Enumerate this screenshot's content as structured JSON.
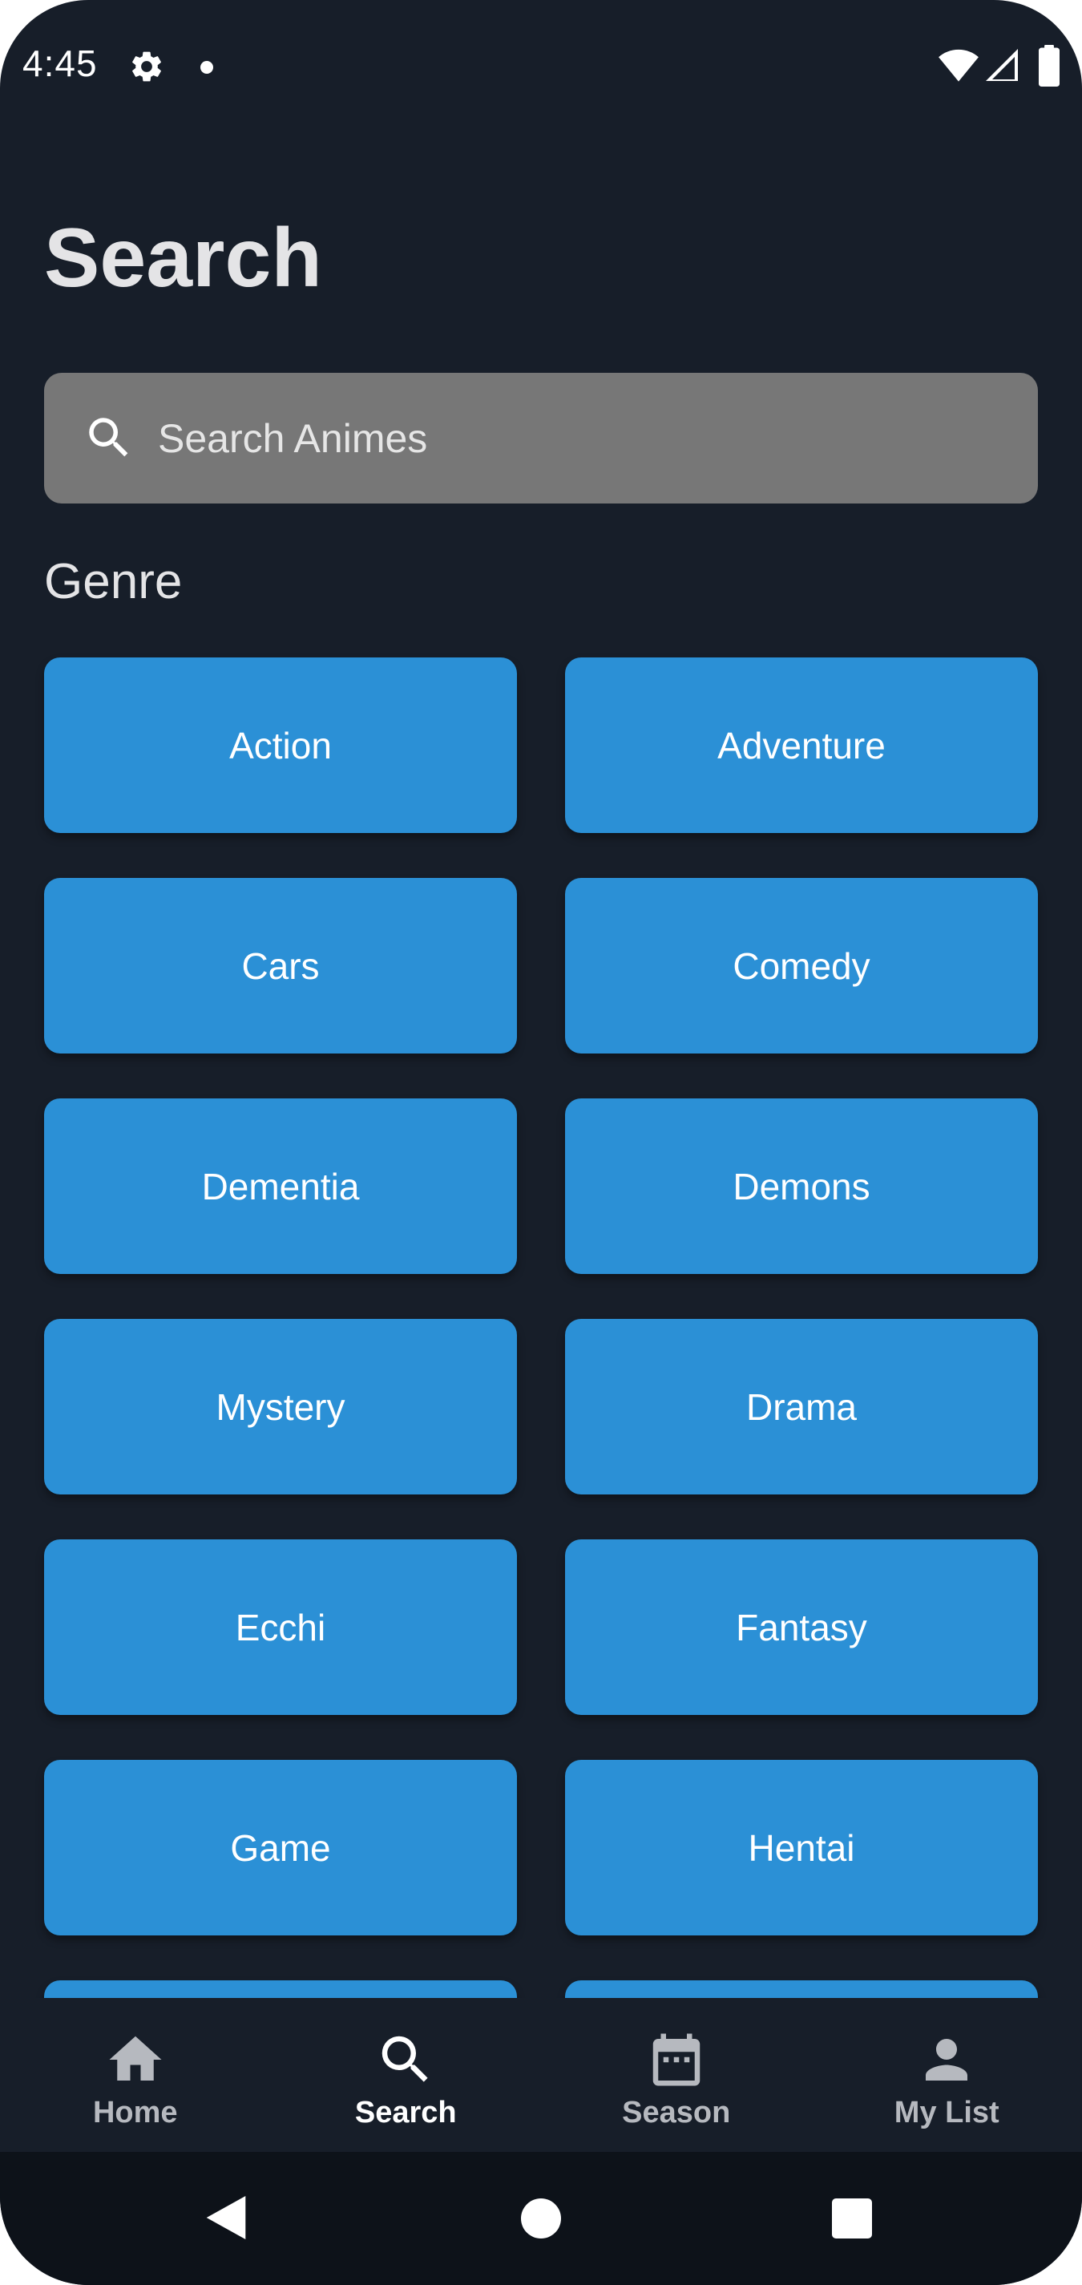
{
  "status_bar": {
    "time": "4:45",
    "icons": [
      "gear-icon",
      "notification-dot",
      "wifi-icon",
      "signal-icon",
      "battery-icon"
    ]
  },
  "page": {
    "title": "Search"
  },
  "search": {
    "placeholder": "Search Animes",
    "value": ""
  },
  "genre": {
    "heading": "Genre",
    "items": [
      {
        "label": "Action"
      },
      {
        "label": "Adventure"
      },
      {
        "label": "Cars"
      },
      {
        "label": "Comedy"
      },
      {
        "label": "Dementia"
      },
      {
        "label": "Demons"
      },
      {
        "label": "Mystery"
      },
      {
        "label": "Drama"
      },
      {
        "label": "Ecchi"
      },
      {
        "label": "Fantasy"
      },
      {
        "label": "Game"
      },
      {
        "label": "Hentai"
      },
      {
        "label": ""
      },
      {
        "label": ""
      }
    ]
  },
  "bottom_nav": {
    "items": [
      {
        "label": "Home",
        "icon": "home-icon",
        "active": false
      },
      {
        "label": "Search",
        "icon": "search-icon",
        "active": true
      },
      {
        "label": "Season",
        "icon": "calendar-icon",
        "active": false
      },
      {
        "label": "My List",
        "icon": "person-icon",
        "active": false
      }
    ]
  },
  "colors": {
    "background": "#171e29",
    "accent": "#2b90d6",
    "search_field": "#777777",
    "system_nav": "#0d1219"
  }
}
